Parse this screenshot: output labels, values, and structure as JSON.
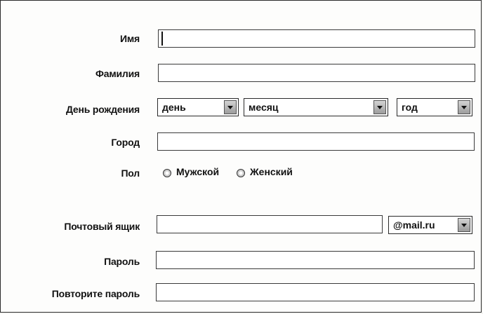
{
  "form": {
    "first_name": {
      "label": "Имя",
      "value": ""
    },
    "last_name": {
      "label": "Фамилия",
      "value": ""
    },
    "birthday": {
      "label": "День рождения",
      "day": "день",
      "month": "месяц",
      "year": "год"
    },
    "city": {
      "label": "Город",
      "value": ""
    },
    "gender": {
      "label": "Пол",
      "male": "Мужской",
      "female": "Женский"
    },
    "mailbox": {
      "label": "Почтовый ящик",
      "value": "",
      "domain": "@mail.ru"
    },
    "password": {
      "label": "Пароль",
      "value": ""
    },
    "password_repeat": {
      "label": "Повторите пароль",
      "value": ""
    }
  },
  "icons": {
    "dropdown": "chevron-down-icon",
    "radio": "radio-icon"
  }
}
